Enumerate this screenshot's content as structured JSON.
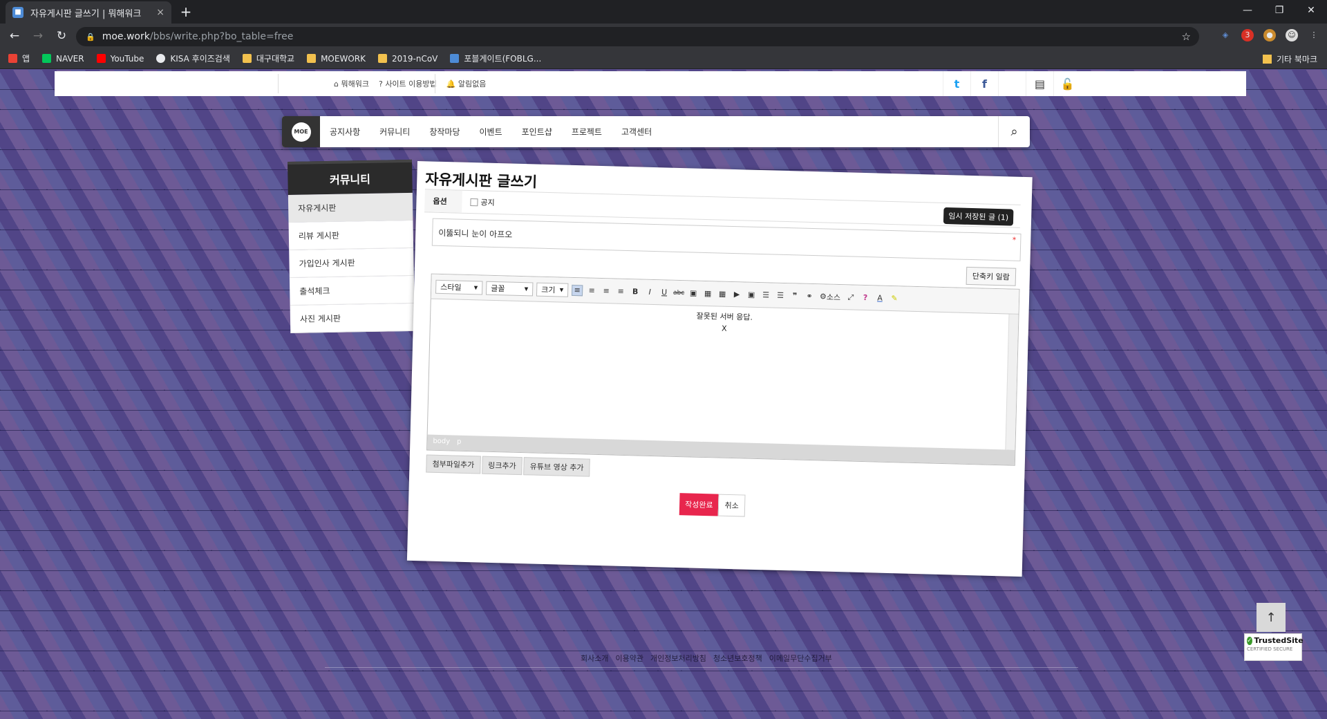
{
  "browser": {
    "tab_title": "자유게시판 글쓰기 | 뭐해워크",
    "tab_close": "×",
    "new_tab": "+",
    "url_host": "moe.work",
    "url_path": "/bbs/write.php?bo_table=free",
    "bookmarks": [
      {
        "label": "앱",
        "color": "#e94235"
      },
      {
        "label": "NAVER",
        "color": "#03c75a"
      },
      {
        "label": "YouTube",
        "color": "#ff0000"
      },
      {
        "label": "KISA 후이즈검색",
        "color": "#e8eaed"
      },
      {
        "label": "대구대학교",
        "color": "#f2c14e"
      },
      {
        "label": "MOEWORK",
        "color": "#f2c14e"
      },
      {
        "label": "2019-nCoV",
        "color": "#f2c14e"
      },
      {
        "label": "포블게이트(FOBLG...",
        "color": "#4d8bd6"
      }
    ],
    "other_bookmarks": "기타 북마크"
  },
  "topbar": {
    "links": [
      "뭐해워크",
      "사이트 이용방법",
      "알림없음"
    ]
  },
  "nav": {
    "logo_text": "MOE",
    "items": [
      "공지사항",
      "커뮤니티",
      "창작마당",
      "이벤트",
      "포인트샵",
      "프로젝트",
      "고객센터"
    ]
  },
  "sidebar": {
    "title": "커뮤니티",
    "items": [
      "자유게시판",
      "리뷰 게시판",
      "가입인사 게시판",
      "출석체크",
      "사진 게시판"
    ]
  },
  "form": {
    "title": "자유게시판 글쓰기",
    "option_label": "옵션",
    "notice_label": "공지",
    "temp_saved": "임시 저장된 글 (1)",
    "subject_value": "이뚫되니 눈이 아프오",
    "required_mark": "*",
    "shortcut_btn": "단축키 일람",
    "editor": {
      "style_dd": "스타일",
      "font_dd": "글꼴",
      "size_dd": "크기",
      "source_label": "소스",
      "body_line1": "잘못된 서버 응답.",
      "body_line2": "X",
      "status": [
        "body",
        "p"
      ]
    },
    "attach_buttons": [
      "첨부파일추가",
      "링크추가",
      "유튜브 영상 추가"
    ],
    "submit": "작성완료",
    "cancel": "취소"
  },
  "footer": {
    "links": [
      "회사소개",
      "이용약관",
      "개인정보처리방침",
      "청소년보호정책",
      "이메일무단수집거부"
    ]
  },
  "badge": {
    "title": "TrustedSite",
    "subtitle": "CERTIFIED SECURE"
  }
}
